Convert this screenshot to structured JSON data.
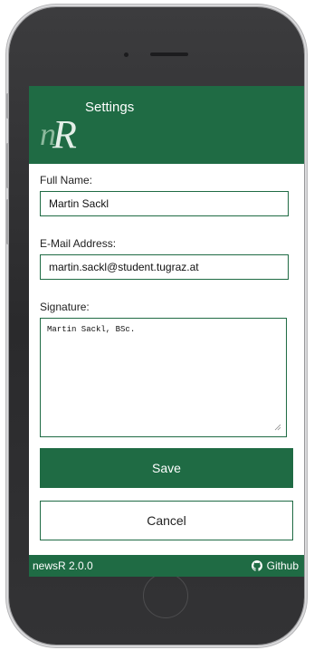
{
  "header": {
    "title": "Settings",
    "logo_text": "nR"
  },
  "form": {
    "full_name": {
      "label": "Full Name:",
      "value": "Martin Sackl"
    },
    "email": {
      "label": "E-Mail Address:",
      "value": "martin.sackl@student.tugraz.at"
    },
    "signature": {
      "label": "Signature:",
      "value": "Martin Sackl, BSc."
    }
  },
  "buttons": {
    "save_label": "Save",
    "cancel_label": "Cancel"
  },
  "footer": {
    "version": "newsR 2.0.0",
    "github_label": "Github"
  },
  "colors": {
    "primary": "#1f6b44",
    "background": "#ffffff",
    "text": "#222222"
  },
  "icons": {
    "footer_link": "github-icon"
  }
}
